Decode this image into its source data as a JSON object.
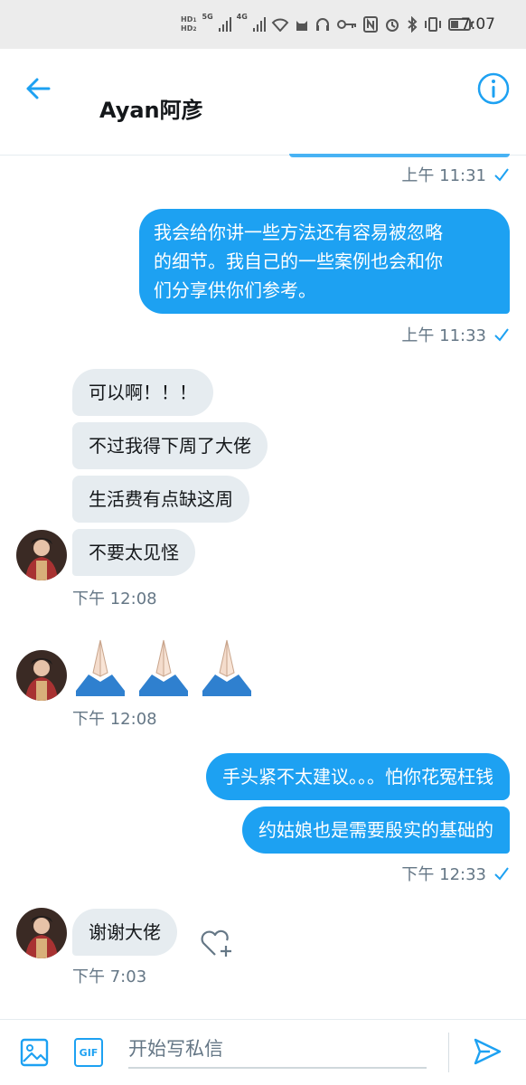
{
  "status_bar": {
    "time": "7:07",
    "hd1": "HD",
    "hd1_sub": "1",
    "hd2": "HD",
    "hd2_sub": "2",
    "net1": "5G",
    "net2": "4G"
  },
  "header": {
    "title": "Ayan阿彦"
  },
  "messages": [
    {
      "meta_time": "上午 11:31"
    },
    {
      "text_line1": "我会给你讲一些方法还有容易被忽略",
      "text_line2": "的细节。我自己的一些案例也会和你",
      "text_line3": "们分享供你们参考。",
      "meta_time": "上午 11:33"
    },
    {
      "texts": [
        "可以啊！！！",
        "不过我得下周了大佬",
        "生活费有点缺这周",
        "不要太见怪"
      ],
      "meta_time": "下午 12:08"
    },
    {
      "emoji": [
        "🙏🏻",
        "🙏🏻",
        "🙏🏻"
      ],
      "meta_time": "下午 12:08"
    },
    {
      "texts": [
        "手头紧不太建议。。。怕你花冤枉钱",
        "约姑娘也是需要殷实的基础的"
      ],
      "meta_time": "下午 12:33"
    },
    {
      "text": "谢谢大佬",
      "meta_time": "下午 7:03"
    }
  ],
  "composer": {
    "placeholder": "开始写私信",
    "gif_label": "GIF"
  },
  "colors": {
    "accent": "#1da1f2",
    "incoming_bg": "#e6ecf0",
    "meta": "#657786"
  }
}
